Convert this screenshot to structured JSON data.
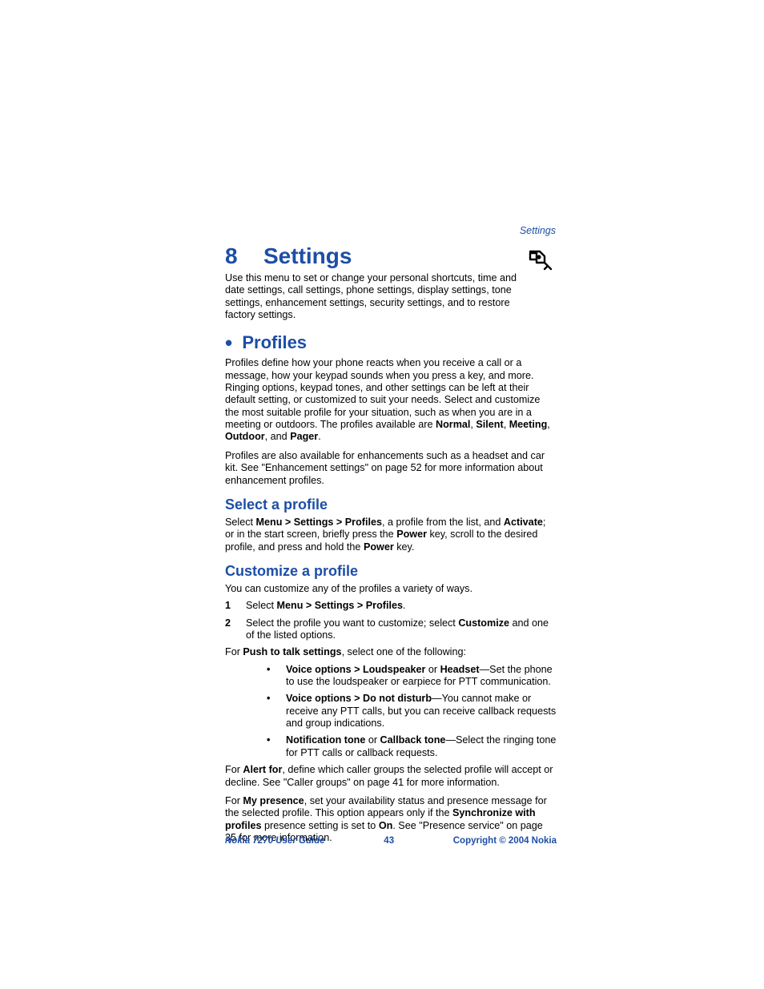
{
  "running_head": "Settings",
  "chapter": {
    "num": "8",
    "title": "Settings"
  },
  "intro": "Use this menu to set or change your personal shortcuts, time and date settings, call settings, phone settings, display settings, tone settings, enhancement settings, security settings, and to restore factory settings.",
  "profiles": {
    "heading": "Profiles",
    "p1_pre": "Profiles define how your phone reacts when you receive a call or a message, how your keypad sounds when you press a key, and more. Ringing options, keypad tones, and other settings can be left at their default setting, or customized to suit your needs. Select and customize the most suitable profile for your situation, such as when you are in a meeting or outdoors. The profiles available are ",
    "p1_b1": "Normal",
    "p1_s1": ", ",
    "p1_b2": "Silent",
    "p1_s2": ", ",
    "p1_b3": "Meeting",
    "p1_s3": ", ",
    "p1_b4": "Outdoor",
    "p1_s4": ", and ",
    "p1_b5": "Pager",
    "p1_s5": ".",
    "p2": "Profiles are also available for enhancements such as a headset and car kit. See \"Enhancement settings\" on page 52 for more information about enhancement profiles."
  },
  "select_profile": {
    "heading": "Select a profile",
    "p_pre": "Select ",
    "p_b1": "Menu > Settings > Profiles",
    "p_mid1": ", a profile from the list, and ",
    "p_b2": "Activate",
    "p_mid2": "; or in the start screen, briefly press the ",
    "p_b3": "Power",
    "p_mid3": " key, scroll to the desired profile, and press and hold the ",
    "p_b4": "Power",
    "p_post": " key."
  },
  "customize": {
    "heading": "Customize a profile",
    "intro": "You can customize any of the profiles a variety of ways.",
    "step1_pre": "Select ",
    "step1_b": "Menu > Settings > Profiles",
    "step1_post": ".",
    "step2_pre": "Select the profile you want to customize; select ",
    "step2_b": "Customize",
    "step2_post": " and one of the listed options.",
    "ptt_intro_pre": "For ",
    "ptt_intro_b": "Push to talk settings",
    "ptt_intro_post": ", select one of the following:",
    "bul1_b1": "Voice options > Loudspeaker",
    "bul1_s1": " or ",
    "bul1_b2": "Headset",
    "bul1_post": "—Set the phone to use the loudspeaker or earpiece for PTT communication.",
    "bul2_b": "Voice options > Do not disturb",
    "bul2_post": "—You cannot make or receive any PTT calls, but you can receive callback requests and group indications.",
    "bul3_b1": "Notification tone",
    "bul3_s1": " or ",
    "bul3_b2": "Callback tone",
    "bul3_post": "—Select the ringing tone for PTT calls or callback requests.",
    "alert_pre": "For ",
    "alert_b": "Alert for",
    "alert_post": ", define which caller groups the selected profile will accept or decline. See \"Caller groups\" on page 41 for more information.",
    "presence_pre": "For ",
    "presence_b1": "My presence",
    "presence_mid1": ", set your availability status and presence message for the selected profile. This option appears only if the ",
    "presence_b2": "Synchronize with profiles",
    "presence_mid2": " presence setting is set to ",
    "presence_b3": "On",
    "presence_post": ". See \"Presence service\" on page 35 for more information."
  },
  "footer": {
    "left": "Nokia 7270 User Guide",
    "mid": "43",
    "right": "Copyright © 2004 Nokia"
  }
}
